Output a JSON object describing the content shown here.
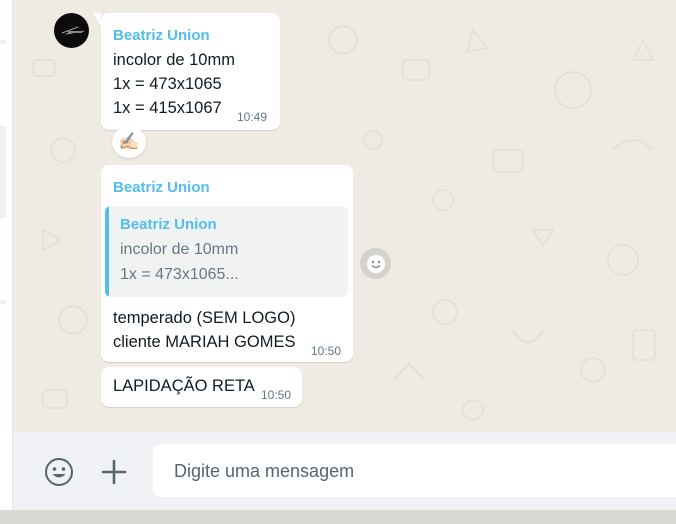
{
  "chat": {
    "messages": [
      {
        "sender": "Beatriz Union",
        "lines": [
          "incolor de 10mm",
          "1x = 473x1065",
          "1x = 415x1067"
        ],
        "time": "10:49",
        "reaction": "✍🏻"
      },
      {
        "sender": "Beatriz Union",
        "quote": {
          "sender": "Beatriz Union",
          "lines": [
            "incolor de 10mm",
            "1x = 473x1065..."
          ]
        },
        "lines": [
          "temperado (SEM LOGO)",
          "cliente MARIAH GOMES"
        ],
        "time": "10:50"
      },
      {
        "lines": [
          "LAPIDAÇÃO RETA"
        ],
        "time": "10:50"
      }
    ]
  },
  "composer": {
    "placeholder": "Digite uma mensagem",
    "emoji_icon": "emoji-icon",
    "attach_icon": "plus-icon"
  },
  "colors": {
    "sender": "#53bdeb",
    "chat_bg": "#efeae2",
    "bubble": "#ffffff",
    "compose_bg": "#f0f2f5"
  }
}
